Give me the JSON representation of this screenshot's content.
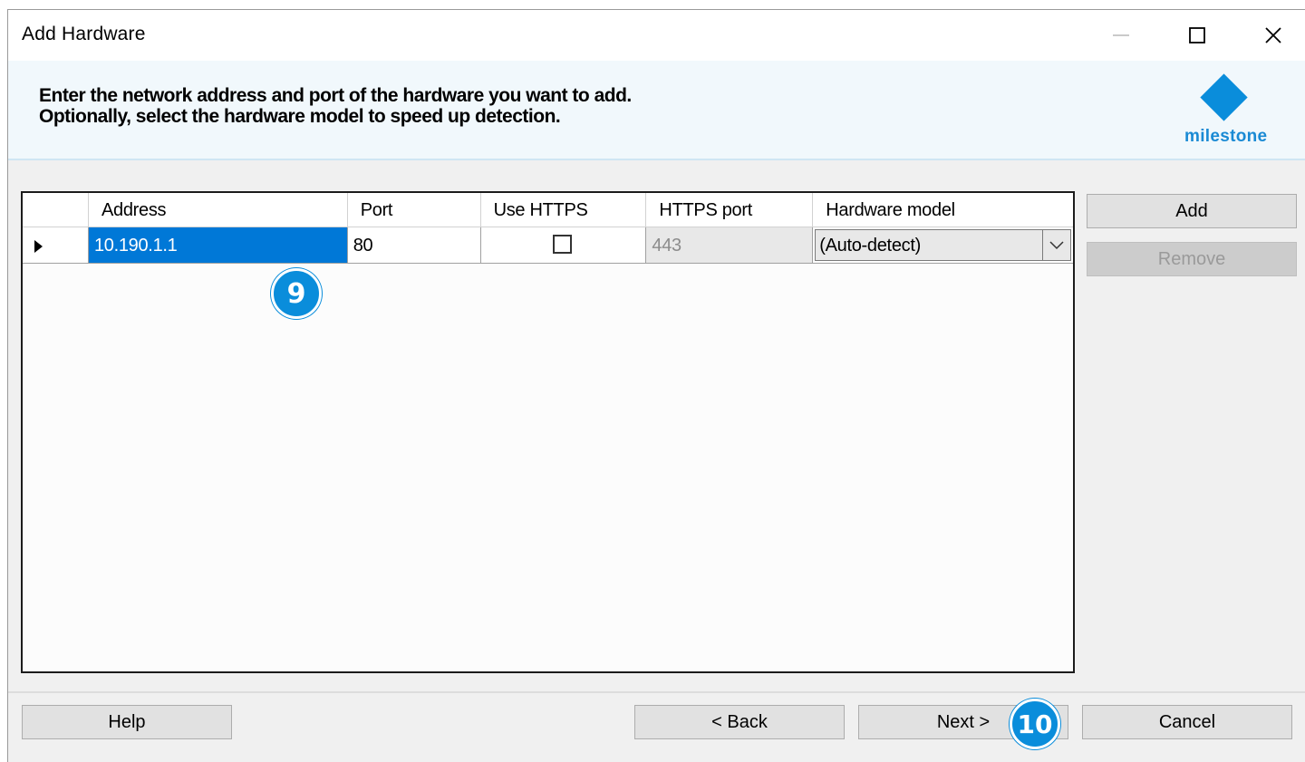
{
  "window": {
    "title": "Add Hardware"
  },
  "header": {
    "line1": "Enter the network address and port of the hardware you want to add.",
    "line2": "Optionally, select the hardware model to speed up detection.",
    "logo_text": "milestone"
  },
  "grid": {
    "columns": [
      "Address",
      "Port",
      "Use HTTPS",
      "HTTPS port",
      "Hardware model"
    ],
    "rows": [
      {
        "address": "10.190.1.1",
        "port": "80",
        "use_https": false,
        "https_port": "443",
        "hardware_model": "(Auto-detect)"
      }
    ]
  },
  "side_buttons": {
    "add": "Add",
    "remove": "Remove"
  },
  "footer": {
    "help": "Help",
    "back": "< Back",
    "next": "Next >",
    "cancel": "Cancel"
  },
  "callouts": {
    "step9": "9",
    "step10": "10"
  },
  "colors": {
    "accent": "#0a8ddb",
    "selection": "#0078d7",
    "header_bg": "#f1f8fc"
  }
}
